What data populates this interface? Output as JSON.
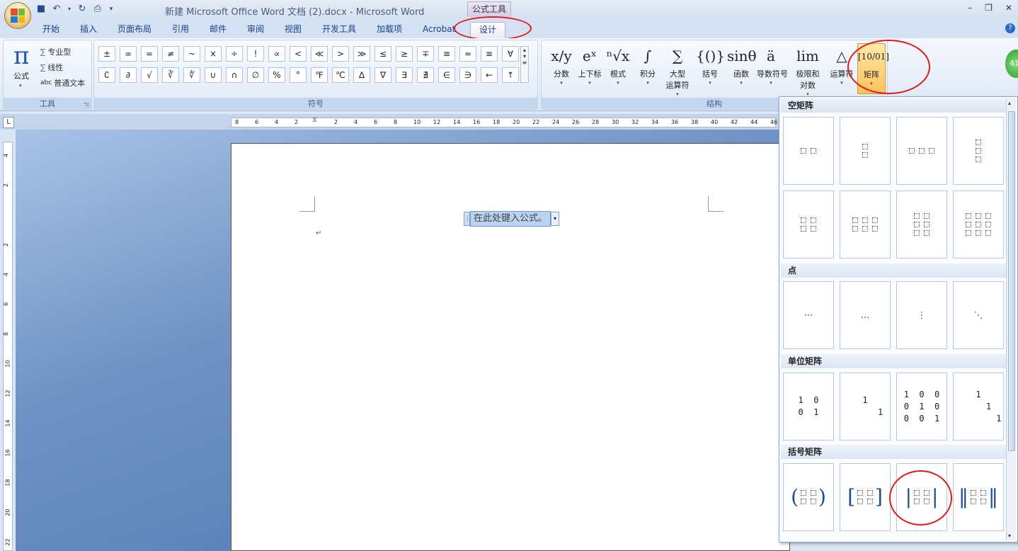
{
  "window": {
    "title": "新建 Microsoft Office Word 文档 (2).docx - Microsoft Word",
    "context_tab_title": "公式工具",
    "controls": [
      "–",
      "❐",
      "✕"
    ]
  },
  "tabs": [
    "开始",
    "插入",
    "页面布局",
    "引用",
    "邮件",
    "审阅",
    "视图",
    "开发工具",
    "加载项",
    "Acrobat",
    "设计"
  ],
  "tools_group": {
    "label": "工具",
    "formula_label": "公式",
    "pi": "π",
    "items": [
      "专业型",
      "线性",
      "普通文本"
    ],
    "abc": "abc"
  },
  "symbols_group": {
    "label": "符号",
    "symbols": [
      "±",
      "∞",
      "=",
      "≠",
      "~",
      "×",
      "÷",
      "!",
      "∝",
      "<",
      "≪",
      ">",
      "≫",
      "≤",
      "≥",
      "∓",
      "≅",
      "≈",
      "≡",
      "∀",
      "∁",
      "∂",
      "√",
      "∛",
      "∜",
      "∪",
      "∩",
      "∅",
      "%",
      "°",
      "℉",
      "℃",
      "∆",
      "∇",
      "∃",
      "∄",
      "∈",
      "∋",
      "←",
      "↑"
    ]
  },
  "structures_group": {
    "label": "结构",
    "items": [
      {
        "glyph": "x/y",
        "label": "分数"
      },
      {
        "glyph": "eˣ",
        "label": "上下标"
      },
      {
        "glyph": "ⁿ√x",
        "label": "根式"
      },
      {
        "glyph": "∫",
        "label": "积分"
      },
      {
        "glyph": "∑",
        "label": "大型\n运算符"
      },
      {
        "glyph": "{()}",
        "label": "括号"
      },
      {
        "glyph": "sinθ",
        "label": "函数"
      },
      {
        "glyph": "ä",
        "label": "导数符号"
      },
      {
        "glyph": "lim",
        "label": "极限和\n对数"
      },
      {
        "glyph": "△",
        "label": "运算符"
      },
      {
        "glyph": "[10/01]",
        "label": "矩阵"
      }
    ]
  },
  "gadget": {
    "text": "41"
  },
  "ruler": {
    "corner": "L",
    "h_ticks": [
      "8",
      "6",
      "4",
      "2",
      "",
      "2",
      "4",
      "6",
      "8",
      "10",
      "12",
      "14",
      "16",
      "18",
      "20",
      "22",
      "24",
      "26",
      "28",
      "30",
      "32",
      "34",
      "36",
      "38",
      "40",
      "42",
      "44",
      "46"
    ],
    "v_ticks": [
      "4",
      "2",
      "",
      "2",
      "4",
      "6",
      "8",
      "10",
      "12",
      "14",
      "16",
      "18",
      "20",
      "22"
    ]
  },
  "document": {
    "placeholder": "在此处键入公式。",
    "para_mark": "↵"
  },
  "gallery": {
    "sections": {
      "empty": "空矩阵",
      "dots": "点",
      "identity": "单位矩阵",
      "bracket": "括号矩阵"
    },
    "dots": [
      "⋯",
      "…",
      "⋮",
      "⋱"
    ],
    "identity": [
      "1  0\n0  1",
      "1\n      1",
      "1  0  0\n0  1  0\n0  0  1",
      "1\n    1\n        1"
    ],
    "brackets": [
      [
        "(",
        ")"
      ],
      [
        "[",
        "]"
      ],
      [
        "|",
        "|"
      ],
      [
        "‖",
        "‖"
      ]
    ]
  }
}
